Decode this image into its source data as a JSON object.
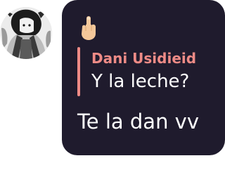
{
  "message": {
    "reaction_icon": "middle-finger-emoji",
    "reply": {
      "author": "Dani Usidieid",
      "text": "Y la leche?"
    },
    "text": "Te la dan vv"
  },
  "colors": {
    "bubble_background": "#1f1b2d",
    "reply_accent": "#ee8b86",
    "message_text": "#ffffff"
  }
}
